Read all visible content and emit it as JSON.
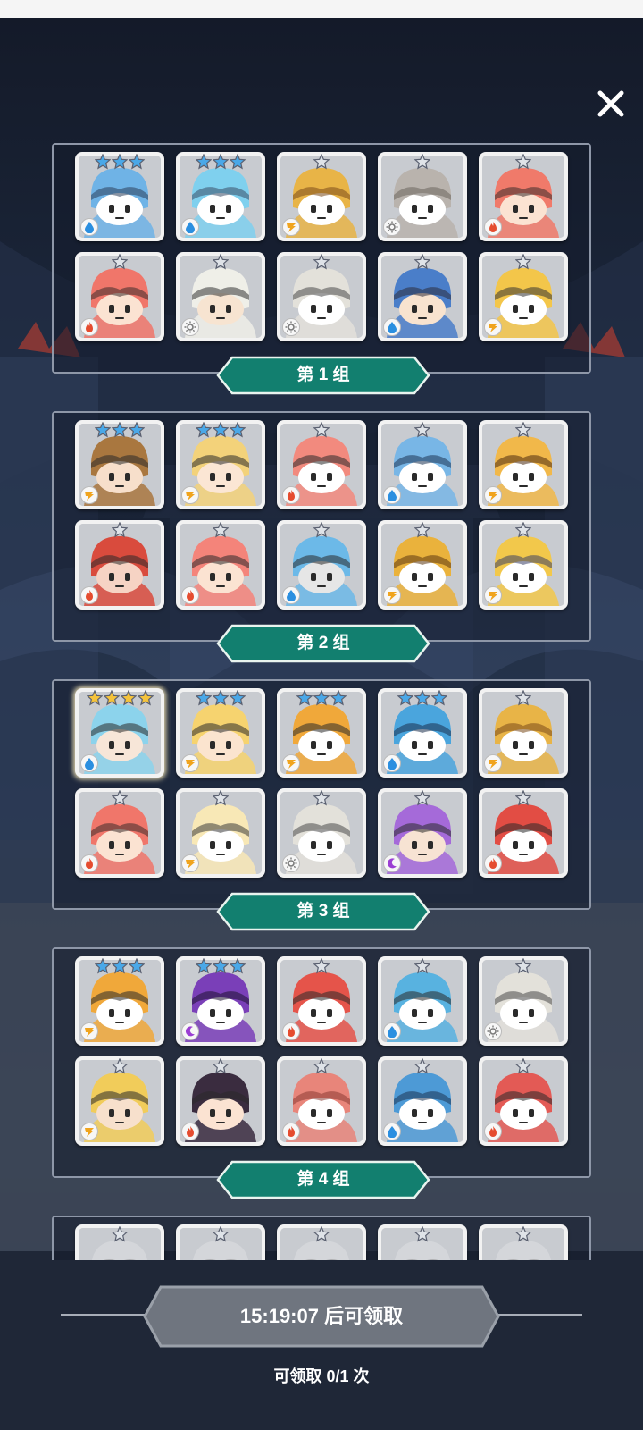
{
  "close_icon": "close-icon",
  "groups": [
    {
      "label": "第 1 组",
      "heroes": [
        {
          "stars": 3,
          "star_color": "blue",
          "element": "water",
          "palette": "blue-skin"
        },
        {
          "stars": 3,
          "star_color": "blue",
          "element": "water",
          "palette": "aqua-creature"
        },
        {
          "stars": 1,
          "star_color": "silver",
          "element": "thunder",
          "palette": "tree-yellow"
        },
        {
          "stars": 1,
          "star_color": "silver",
          "element": "light",
          "palette": "tree-grey"
        },
        {
          "stars": 1,
          "star_color": "silver",
          "element": "fire",
          "palette": "red-hair"
        },
        {
          "stars": 1,
          "star_color": "silver",
          "element": "fire",
          "palette": "red-skull"
        },
        {
          "stars": 1,
          "star_color": "silver",
          "element": "light",
          "palette": "white-cat"
        },
        {
          "stars": 1,
          "star_color": "silver",
          "element": "light",
          "palette": "shell-grey"
        },
        {
          "stars": 1,
          "star_color": "silver",
          "element": "water",
          "palette": "blue-witch"
        },
        {
          "stars": 1,
          "star_color": "silver",
          "element": "thunder",
          "palette": "gold-knight"
        }
      ]
    },
    {
      "label": "第 2 组",
      "heroes": [
        {
          "stars": 3,
          "star_color": "blue",
          "element": "thunder",
          "palette": "brown-warrior"
        },
        {
          "stars": 3,
          "star_color": "blue",
          "element": "thunder",
          "palette": "blonde-girl"
        },
        {
          "stars": 1,
          "star_color": "silver",
          "element": "fire",
          "palette": "bandage-pink"
        },
        {
          "stars": 1,
          "star_color": "silver",
          "element": "water",
          "palette": "blue-skull"
        },
        {
          "stars": 1,
          "star_color": "silver",
          "element": "thunder",
          "palette": "yellow-cat"
        },
        {
          "stars": 1,
          "star_color": "silver",
          "element": "fire",
          "palette": "red-dragon"
        },
        {
          "stars": 1,
          "star_color": "silver",
          "element": "fire",
          "palette": "pink-bug"
        },
        {
          "stars": 1,
          "star_color": "silver",
          "element": "water",
          "palette": "blue-knight"
        },
        {
          "stars": 1,
          "star_color": "silver",
          "element": "thunder",
          "palette": "yellow-beast"
        },
        {
          "stars": 1,
          "star_color": "silver",
          "element": "thunder",
          "palette": "white-robot"
        }
      ]
    },
    {
      "label": "第 3 组",
      "heroes": [
        {
          "stars": 4,
          "star_color": "gold",
          "element": "water",
          "palette": "cyan-elf",
          "highlight": true
        },
        {
          "stars": 3,
          "star_color": "blue",
          "element": "thunder",
          "palette": "blonde-long"
        },
        {
          "stars": 3,
          "star_color": "blue",
          "element": "thunder",
          "palette": "tiger"
        },
        {
          "stars": 3,
          "star_color": "blue",
          "element": "water",
          "palette": "blue-monster"
        },
        {
          "stars": 1,
          "star_color": "silver",
          "element": "thunder",
          "palette": "tree-yellow"
        },
        {
          "stars": 1,
          "star_color": "silver",
          "element": "fire",
          "palette": "red-skull"
        },
        {
          "stars": 1,
          "star_color": "silver",
          "element": "thunder",
          "palette": "cream-ghost"
        },
        {
          "stars": 1,
          "star_color": "silver",
          "element": "light",
          "palette": "shell-grey"
        },
        {
          "stars": 1,
          "star_color": "silver",
          "element": "dark",
          "palette": "purple-girl"
        },
        {
          "stars": 1,
          "star_color": "silver",
          "element": "fire",
          "palette": "red-robot"
        }
      ]
    },
    {
      "label": "第 4 组",
      "heroes": [
        {
          "stars": 3,
          "star_color": "blue",
          "element": "thunder",
          "palette": "tiger"
        },
        {
          "stars": 3,
          "star_color": "blue",
          "element": "dark",
          "palette": "purple-monster"
        },
        {
          "stars": 1,
          "star_color": "silver",
          "element": "fire",
          "palette": "red-bird"
        },
        {
          "stars": 1,
          "star_color": "silver",
          "element": "water",
          "palette": "blue-bird"
        },
        {
          "stars": 1,
          "star_color": "silver",
          "element": "light",
          "palette": "shell-grey"
        },
        {
          "stars": 1,
          "star_color": "silver",
          "element": "thunder",
          "palette": "gold-helmet"
        },
        {
          "stars": 1,
          "star_color": "silver",
          "element": "fire",
          "palette": "dark-hair-girl"
        },
        {
          "stars": 1,
          "star_color": "silver",
          "element": "fire",
          "palette": "moai"
        },
        {
          "stars": 1,
          "star_color": "silver",
          "element": "water",
          "palette": "blue-totem"
        },
        {
          "stars": 1,
          "star_color": "silver",
          "element": "fire",
          "palette": "red-pirate"
        }
      ]
    },
    {
      "label": "",
      "heroes": [
        {
          "stars": 1,
          "star_color": "silver",
          "element": "none",
          "palette": "grey"
        },
        {
          "stars": 1,
          "star_color": "silver",
          "element": "none",
          "palette": "grey"
        },
        {
          "stars": 1,
          "star_color": "silver",
          "element": "none",
          "palette": "grey"
        },
        {
          "stars": 1,
          "star_color": "silver",
          "element": "none",
          "palette": "grey"
        },
        {
          "stars": 1,
          "star_color": "silver",
          "element": "none",
          "palette": "grey"
        }
      ]
    }
  ],
  "footer": {
    "timer_label": "15:19:07 后可领取",
    "claim_count": "可领取 0/1 次"
  },
  "colors": {
    "label_teal": "#127f6f",
    "button_grey": "#6f757f",
    "star_blue": "#4aa8e8",
    "star_gold": "#f5c33b",
    "star_silver": "#dfe3e8"
  },
  "palettes": {
    "blue-skin": [
      "#6fb3e6",
      "#2c3e5a",
      "#ffffff"
    ],
    "aqua-creature": [
      "#7fd0ee",
      "#3b4d66",
      "#ffffff"
    ],
    "tree-yellow": [
      "#e8b447",
      "#7a4a1a",
      "#ffffff"
    ],
    "tree-grey": [
      "#b9b3ad",
      "#6b645c",
      "#ffffff"
    ],
    "red-hair": [
      "#f07a6a",
      "#3a2c2a",
      "#fbe3d2"
    ],
    "red-skull": [
      "#f0766a",
      "#3a2c2a",
      "#fbe3d2"
    ],
    "white-cat": [
      "#efefe8",
      "#333333",
      "#f7e4d1"
    ],
    "shell-grey": [
      "#e3e1da",
      "#4a4a4a",
      "#ffffff"
    ],
    "blue-witch": [
      "#4a7ec9",
      "#2b2b3a",
      "#f8e3cf"
    ],
    "gold-knight": [
      "#f3c64a",
      "#333333",
      "#ffffff"
    ],
    "brown-warrior": [
      "#a9773f",
      "#2a2a2a",
      "#f7dfcb"
    ],
    "blonde-girl": [
      "#f3d27a",
      "#2a2a2a",
      "#fbe6d4"
    ],
    "bandage-pink": [
      "#f28a7e",
      "#2a2a2a",
      "#ffffff"
    ],
    "blue-skull": [
      "#78b6e6",
      "#1e3554",
      "#ffffff"
    ],
    "yellow-cat": [
      "#f1b84a",
      "#4a2a10",
      "#ffffff"
    ],
    "red-dragon": [
      "#d94b3d",
      "#2a2a2a",
      "#f6d3c4"
    ],
    "pink-bug": [
      "#f4847a",
      "#2a2a2a",
      "#fbe3d2"
    ],
    "blue-knight": [
      "#6cb9e8",
      "#2a2a2a",
      "#e6e6e6"
    ],
    "yellow-beast": [
      "#eab23c",
      "#5b3610",
      "#ffffff"
    ],
    "white-robot": [
      "#f2c84b",
      "#3a3f66",
      "#ffffff"
    ],
    "cyan-elf": [
      "#8cd3ec",
      "#2a2a2a",
      "#f7e6d8"
    ],
    "blonde-long": [
      "#f6d36f",
      "#2a2a2a",
      "#fbe4cf"
    ],
    "tiger": [
      "#f0a83a",
      "#2a2a2a",
      "#ffffff"
    ],
    "blue-monster": [
      "#4aa5dd",
      "#1b2f4d",
      "#ffffff"
    ],
    "cream-ghost": [
      "#f8e8b6",
      "#3a3a3a",
      "#ffffff"
    ],
    "purple-girl": [
      "#a56ad9",
      "#2a2a2a",
      "#f7e3d3"
    ],
    "red-robot": [
      "#e24d44",
      "#2a2a2a",
      "#ffffff"
    ],
    "purple-monster": [
      "#7a3fb8",
      "#1e1230",
      "#ffffff"
    ],
    "red-bird": [
      "#e5544a",
      "#2a2a2a",
      "#ffffff"
    ],
    "blue-bird": [
      "#58b2e0",
      "#2a2a2a",
      "#ffffff"
    ],
    "gold-helmet": [
      "#f1cc5a",
      "#2a2a2a",
      "#f7e0cc"
    ],
    "dark-hair-girl": [
      "#3a2c3f",
      "#2a2a2a",
      "#fbe3d2"
    ],
    "moai": [
      "#e8857a",
      "#8a3a33",
      "#ffffff"
    ],
    "blue-totem": [
      "#4d9ad6",
      "#1e3554",
      "#ffffff"
    ],
    "red-pirate": [
      "#e35a55",
      "#2a2a2a",
      "#ffffff"
    ],
    "grey": [
      "#d4d6da",
      "#888888",
      "#ffffff"
    ]
  }
}
